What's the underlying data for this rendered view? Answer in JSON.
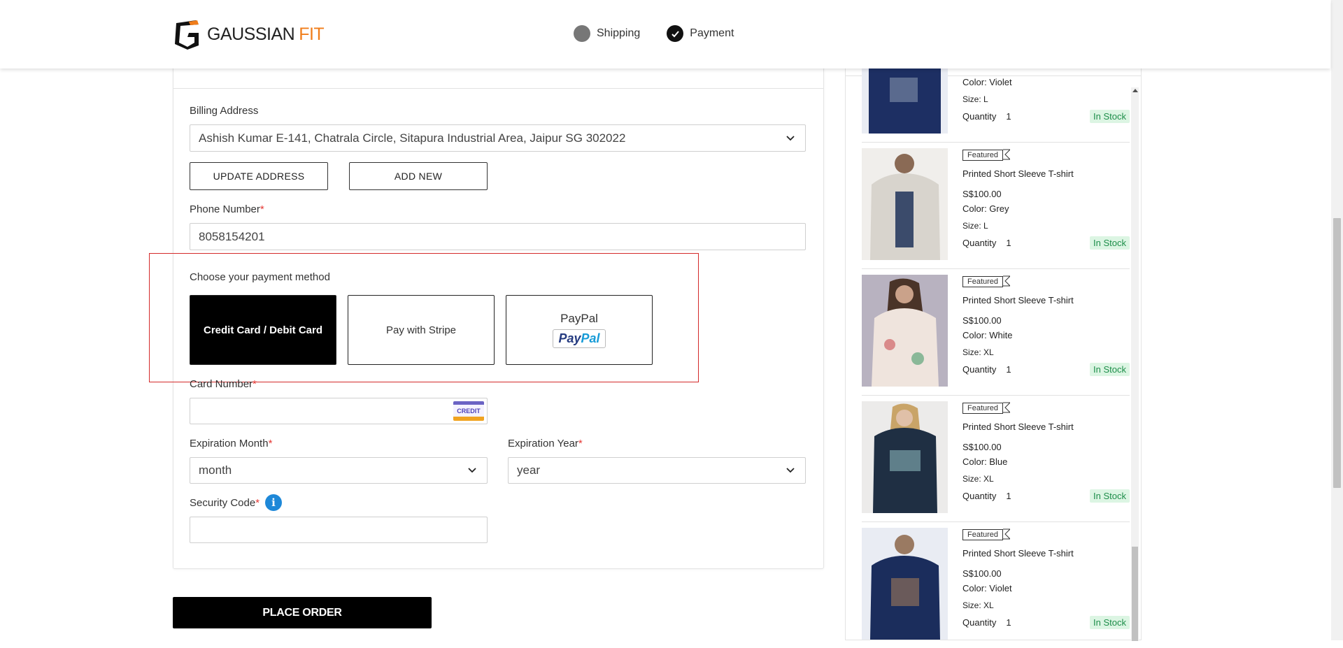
{
  "brand": {
    "name_main": "GAUSSIAN",
    "name_accent": "FIT",
    "accent_color": "#f07d1a"
  },
  "steps": [
    {
      "label": "Shipping",
      "state": "inactive"
    },
    {
      "label": "Payment",
      "state": "completed"
    }
  ],
  "billing": {
    "label": "Billing Address",
    "selected": "Ashish Kumar E-141, Chatrala Circle, Sitapura Industrial Area, Jaipur SG 302022",
    "update_label": "UPDATE ADDRESS",
    "add_label": "ADD NEW"
  },
  "phone": {
    "label": "Phone Number",
    "required": "*",
    "value": "8058154201"
  },
  "payment": {
    "heading": "Choose your payment method",
    "methods": [
      {
        "label": "Credit Card / Debit Card",
        "selected": true
      },
      {
        "label": "Pay with Stripe",
        "selected": false
      },
      {
        "label": "PayPal",
        "badge_a": "Pay",
        "badge_b": "Pal",
        "selected": false
      }
    ]
  },
  "card": {
    "label": "Card Number",
    "required": "*",
    "value": "",
    "badge": "CREDIT"
  },
  "exp_month": {
    "label": "Expiration Month",
    "required": "*",
    "value": "month"
  },
  "exp_year": {
    "label": "Expiration Year",
    "required": "*",
    "value": "year"
  },
  "security": {
    "label": "Security Code",
    "required": "*",
    "value": "",
    "info_icon": "i"
  },
  "place_order": "PLACE ORDER",
  "cart_items": [
    {
      "featured": "",
      "name": "",
      "price": "",
      "color": "Color: Violet",
      "size": "Size: L",
      "qty_label": "Quantity",
      "qty": "1",
      "stock": "In Stock"
    },
    {
      "featured": "Featured",
      "name": "Printed Short Sleeve T-shirt",
      "price": "S$100.00",
      "color": "Color: Grey",
      "size": "Size: L",
      "qty_label": "Quantity",
      "qty": "1",
      "stock": "In Stock"
    },
    {
      "featured": "Featured",
      "name": "Printed Short Sleeve T-shirt",
      "price": "S$100.00",
      "color": "Color: White",
      "size": "Size: XL",
      "qty_label": "Quantity",
      "qty": "1",
      "stock": "In Stock"
    },
    {
      "featured": "Featured",
      "name": "Printed Short Sleeve T-shirt",
      "price": "S$100.00",
      "color": "Color: Blue",
      "size": "Size: XL",
      "qty_label": "Quantity",
      "qty": "1",
      "stock": "In Stock"
    },
    {
      "featured": "Featured",
      "name": "Printed Short Sleeve T-shirt",
      "price": "S$100.00",
      "color": "Color: Violet",
      "size": "Size: XL",
      "qty_label": "Quantity",
      "qty": "1",
      "stock": "In Stock"
    }
  ]
}
